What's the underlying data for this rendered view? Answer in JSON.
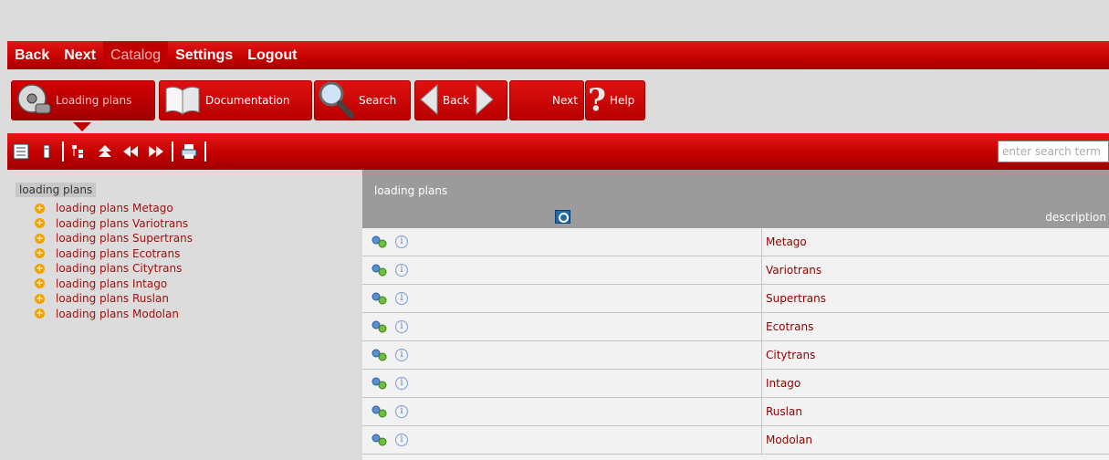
{
  "menu": {
    "items": [
      {
        "label": "Back"
      },
      {
        "label": "Next"
      },
      {
        "label": "Catalog",
        "active": true
      },
      {
        "label": "Settings"
      },
      {
        "label": "Logout"
      }
    ]
  },
  "toolbar": {
    "loading_plans": "Loading plans",
    "documentation": "Documentation",
    "search": "Search",
    "back": "Back",
    "next": "Next",
    "help": "Help"
  },
  "search": {
    "placeholder": "enter search term"
  },
  "tree": {
    "root": "loading plans",
    "items": [
      {
        "label": "loading plans Metago"
      },
      {
        "label": "loading plans Variotrans"
      },
      {
        "label": "loading plans Supertrans"
      },
      {
        "label": "loading plans Ecotrans"
      },
      {
        "label": "loading plans Citytrans"
      },
      {
        "label": "loading plans Intago"
      },
      {
        "label": "loading plans Ruslan"
      },
      {
        "label": "loading plans Modolan"
      }
    ]
  },
  "table": {
    "title": "loading plans",
    "description_header": "description",
    "rows": [
      {
        "description": "Metago"
      },
      {
        "description": "Variotrans"
      },
      {
        "description": "Supertrans"
      },
      {
        "description": "Ecotrans"
      },
      {
        "description": "Citytrans"
      },
      {
        "description": "Intago"
      },
      {
        "description": "Ruslan"
      },
      {
        "description": "Modolan"
      }
    ]
  },
  "colors": {
    "brand_red": "#c40000",
    "link_red": "#a01010",
    "panel_header": "#9b9b9b",
    "plus_orange": "#f0a300"
  }
}
